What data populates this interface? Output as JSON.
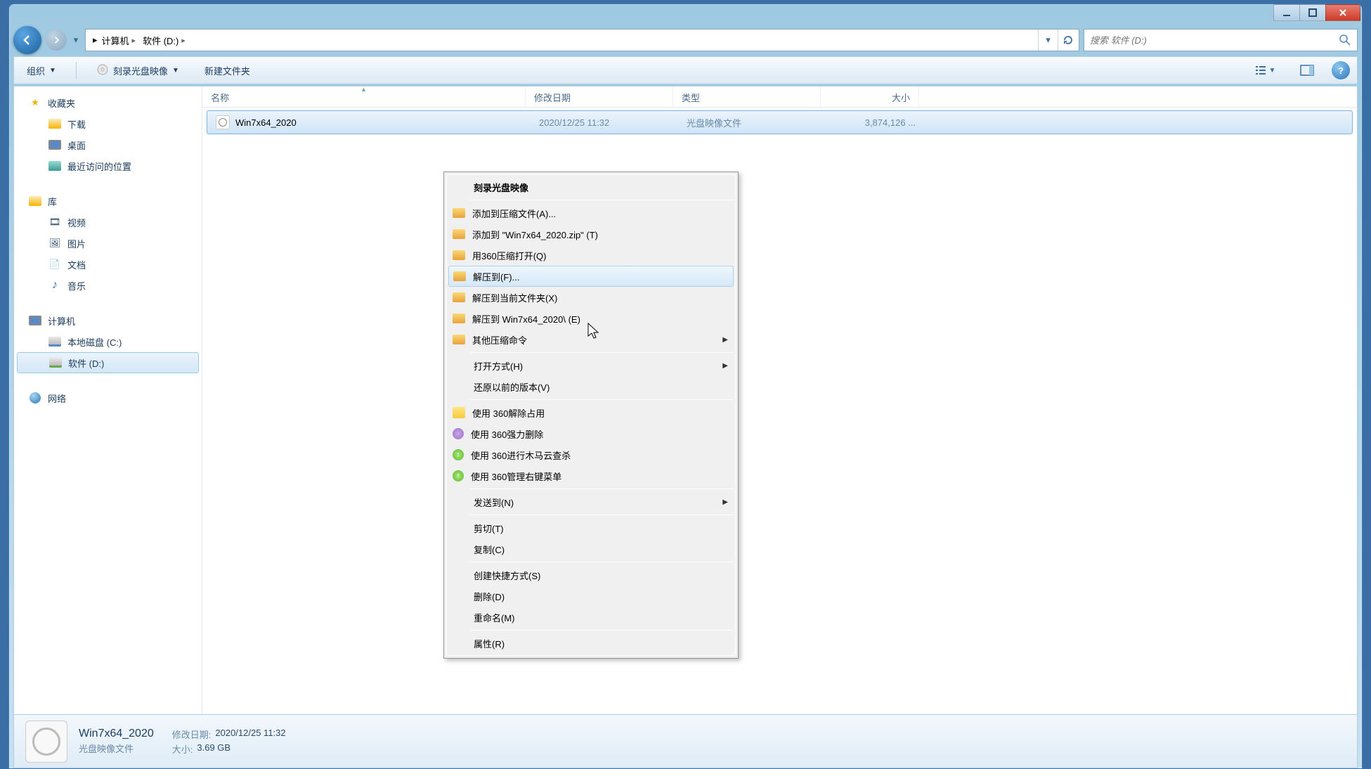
{
  "window": {
    "breadcrumbs": [
      "计算机",
      "软件 (D:)"
    ],
    "search_placeholder": "搜索 软件 (D:)"
  },
  "toolbar": {
    "organize": "组织",
    "burn_image": "刻录光盘映像",
    "new_folder": "新建文件夹"
  },
  "sidebar": {
    "favorites": {
      "label": "收藏夹",
      "items": [
        "下载",
        "桌面",
        "最近访问的位置"
      ]
    },
    "libraries": {
      "label": "库",
      "items": [
        "视频",
        "图片",
        "文档",
        "音乐"
      ]
    },
    "computer": {
      "label": "计算机",
      "items": [
        "本地磁盘 (C:)",
        "软件 (D:)"
      ]
    },
    "network": {
      "label": "网络"
    }
  },
  "columns": {
    "name": "名称",
    "date": "修改日期",
    "type": "类型",
    "size": "大小"
  },
  "files": [
    {
      "name": "Win7x64_2020",
      "date": "2020/12/25 11:32",
      "type": "光盘映像文件",
      "size": "3,874,126 ..."
    }
  ],
  "context_menu": {
    "items": [
      {
        "label": "刻录光盘映像",
        "bold": true
      },
      {
        "sep": true
      },
      {
        "label": "添加到压缩文件(A)...",
        "icon": "archive"
      },
      {
        "label": "添加到 \"Win7x64_2020.zip\" (T)",
        "icon": "archive"
      },
      {
        "label": "用360压缩打开(Q)",
        "icon": "archive"
      },
      {
        "label": "解压到(F)...",
        "icon": "archive",
        "hover": true
      },
      {
        "label": "解压到当前文件夹(X)",
        "icon": "archive"
      },
      {
        "label": "解压到 Win7x64_2020\\ (E)",
        "icon": "archive"
      },
      {
        "label": "其他压缩命令",
        "icon": "archive",
        "submenu": true
      },
      {
        "sep": true
      },
      {
        "label": "打开方式(H)",
        "submenu": true
      },
      {
        "label": "还原以前的版本(V)"
      },
      {
        "sep": true
      },
      {
        "label": "使用 360解除占用",
        "icon": "yellow"
      },
      {
        "label": "使用 360强力删除",
        "icon": "purple"
      },
      {
        "label": "使用 360进行木马云查杀",
        "icon": "green"
      },
      {
        "label": "使用 360管理右键菜单",
        "icon": "green"
      },
      {
        "sep": true
      },
      {
        "label": "发送到(N)",
        "submenu": true
      },
      {
        "sep": true
      },
      {
        "label": "剪切(T)"
      },
      {
        "label": "复制(C)"
      },
      {
        "sep": true
      },
      {
        "label": "创建快捷方式(S)"
      },
      {
        "label": "删除(D)"
      },
      {
        "label": "重命名(M)"
      },
      {
        "sep": true
      },
      {
        "label": "属性(R)"
      }
    ]
  },
  "details": {
    "name": "Win7x64_2020",
    "type": "光盘映像文件",
    "date_label": "修改日期:",
    "date": "2020/12/25 11:32",
    "size_label": "大小:",
    "size": "3.69 GB"
  }
}
